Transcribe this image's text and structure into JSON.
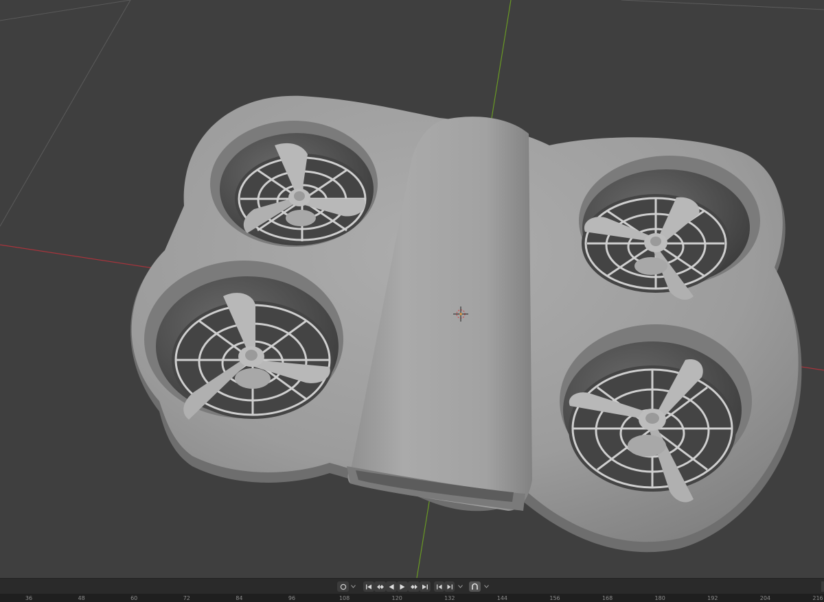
{
  "viewport": {
    "object": "drone-model",
    "icons": [
      "origin-marker-icon"
    ]
  },
  "playback": {
    "keying_icon": "record-circle-icon",
    "transport_icons": [
      "jump-to-start-icon",
      "jump-to-prev-keyframe-icon",
      "play-reverse-icon",
      "play-icon",
      "jump-to-next-keyframe-icon",
      "jump-to-end-icon"
    ],
    "frame_step_icons": [
      "prev-frame-icon",
      "next-frame-icon"
    ],
    "snap_icon": "magnet-icon"
  },
  "timeline": {
    "frame_ticks": [
      "36",
      "48",
      "60",
      "72",
      "84",
      "96",
      "108",
      "120",
      "132",
      "144",
      "156",
      "168",
      "180",
      "192",
      "204",
      "216"
    ]
  }
}
